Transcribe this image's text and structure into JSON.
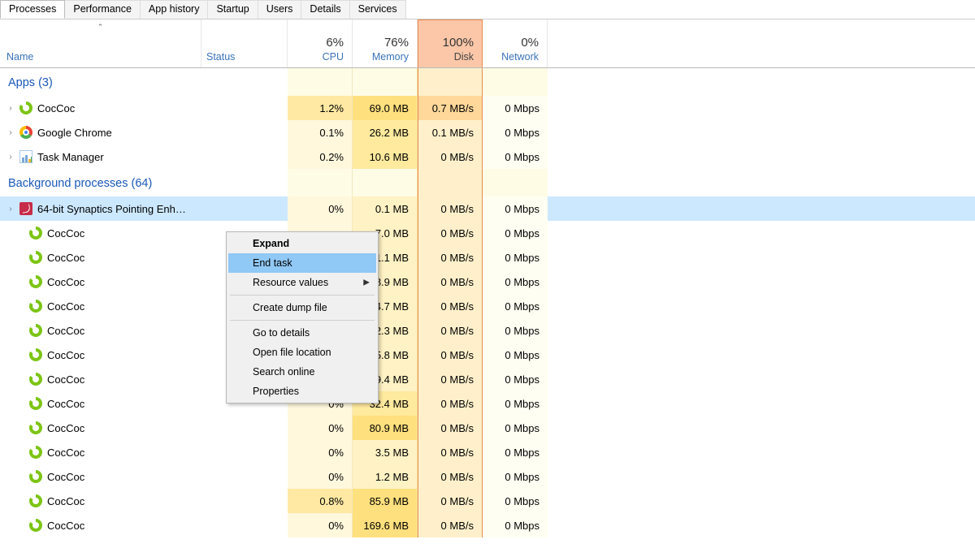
{
  "tabs": [
    "Processes",
    "Performance",
    "App history",
    "Startup",
    "Users",
    "Details",
    "Services"
  ],
  "activeTab": 0,
  "columns": {
    "name": "Name",
    "status": "Status",
    "cpu": {
      "pct": "6%",
      "label": "CPU"
    },
    "memory": {
      "pct": "76%",
      "label": "Memory"
    },
    "disk": {
      "pct": "100%",
      "label": "Disk"
    },
    "network": {
      "pct": "0%",
      "label": "Network"
    }
  },
  "groups": [
    {
      "title": "Apps (3)",
      "rows": [
        {
          "exp": true,
          "icon": "coccoc",
          "name": "CocCoc",
          "cpu": "1.2%",
          "mem": "69.0 MB",
          "disk": "0.7 MB/s",
          "diskHot": true,
          "net": "0 Mbps",
          "cpuH": true,
          "memH": 1
        },
        {
          "exp": true,
          "icon": "chrome",
          "name": "Google Chrome",
          "cpu": "0.1%",
          "mem": "26.2 MB",
          "disk": "0.1 MB/s",
          "net": "0 Mbps",
          "memH": 2
        },
        {
          "exp": true,
          "icon": "tm",
          "name": "Task Manager",
          "cpu": "0.2%",
          "mem": "10.6 MB",
          "disk": "0 MB/s",
          "net": "0 Mbps",
          "memH": 2
        }
      ]
    },
    {
      "title": "Background processes (64)",
      "rows": [
        {
          "exp": true,
          "icon": "syn",
          "name": "64-bit Synaptics Pointing Enhan...",
          "cpu": "0%",
          "mem": "0.1 MB",
          "disk": "0 MB/s",
          "net": "0 Mbps",
          "selected": true
        },
        {
          "icon": "coccoc",
          "name": "CocCoc",
          "cpu": "",
          "mem": "7.0 MB",
          "disk": "0 MB/s",
          "net": "0 Mbps"
        },
        {
          "icon": "coccoc",
          "name": "CocCoc",
          "cpu": "",
          "mem": "1.1 MB",
          "disk": "0 MB/s",
          "net": "0 Mbps"
        },
        {
          "icon": "coccoc",
          "name": "CocCoc",
          "cpu": "",
          "mem": "8.9 MB",
          "disk": "0 MB/s",
          "net": "0 Mbps"
        },
        {
          "icon": "coccoc",
          "name": "CocCoc",
          "cpu": "",
          "mem": "4.7 MB",
          "disk": "0 MB/s",
          "net": "0 Mbps"
        },
        {
          "icon": "coccoc",
          "name": "CocCoc",
          "cpu": "",
          "mem": "2.3 MB",
          "disk": "0 MB/s",
          "net": "0 Mbps"
        },
        {
          "icon": "coccoc",
          "name": "CocCoc",
          "cpu": "",
          "mem": "5.8 MB",
          "disk": "0 MB/s",
          "net": "0 Mbps"
        },
        {
          "icon": "coccoc",
          "name": "CocCoc",
          "cpu": "",
          "mem": "9.4 MB",
          "disk": "0 MB/s",
          "net": "0 Mbps"
        },
        {
          "icon": "coccoc",
          "name": "CocCoc",
          "cpu": "0%",
          "mem": "32.4 MB",
          "disk": "0 MB/s",
          "net": "0 Mbps",
          "memH": 2
        },
        {
          "icon": "coccoc",
          "name": "CocCoc",
          "cpu": "0%",
          "mem": "80.9 MB",
          "disk": "0 MB/s",
          "net": "0 Mbps",
          "memH": 1
        },
        {
          "icon": "coccoc",
          "name": "CocCoc",
          "cpu": "0%",
          "mem": "3.5 MB",
          "disk": "0 MB/s",
          "net": "0 Mbps"
        },
        {
          "icon": "coccoc",
          "name": "CocCoc",
          "cpu": "0%",
          "mem": "1.2 MB",
          "disk": "0 MB/s",
          "net": "0 Mbps"
        },
        {
          "icon": "coccoc",
          "name": "CocCoc",
          "cpu": "0.8%",
          "mem": "85.9 MB",
          "disk": "0 MB/s",
          "net": "0 Mbps",
          "cpuH": true,
          "memH": 1
        },
        {
          "icon": "coccoc",
          "name": "CocCoc",
          "cpu": "0%",
          "mem": "169.6 MB",
          "disk": "0 MB/s",
          "net": "0 Mbps",
          "memH": 1
        }
      ]
    }
  ],
  "contextMenu": {
    "items": [
      {
        "label": "Expand",
        "bold": true
      },
      {
        "label": "End task",
        "hover": true
      },
      {
        "label": "Resource values",
        "submenu": true
      },
      {
        "sep": true
      },
      {
        "label": "Create dump file"
      },
      {
        "sep": true
      },
      {
        "label": "Go to details"
      },
      {
        "label": "Open file location"
      },
      {
        "label": "Search online"
      },
      {
        "label": "Properties"
      }
    ]
  }
}
